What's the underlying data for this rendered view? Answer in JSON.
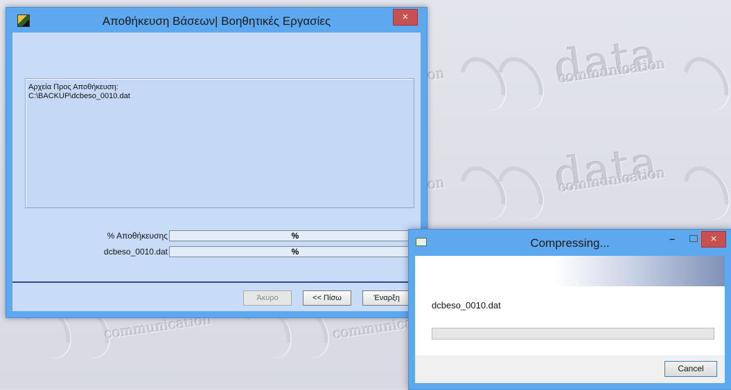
{
  "desktop": {
    "watermark_brand": "data",
    "watermark_sub": "communication",
    "watermark_fragment": "on"
  },
  "main_dialog": {
    "title": "Αποθήκευση Βάσεων| Βοηθητικές Εργασίες",
    "close_label": "×",
    "files_label": "Αρχεία Προς Αποθήκευση:",
    "file_path": "C:\\BACKUP\\dcbeso_0010.dat",
    "progress": [
      {
        "label": "% Αποθήκευσης",
        "value_text": "%"
      },
      {
        "label": "dcbeso_0010.dat",
        "value_text": "%"
      }
    ],
    "buttons": {
      "cancel": "Άκυρο",
      "back": "<< Πίσω",
      "start": "Έναρξη"
    }
  },
  "compress_dialog": {
    "title": "Compressing...",
    "minimize_label": "–",
    "close_label": "×",
    "file_name": "dcbeso_0010.dat",
    "progress_fraction": 0,
    "cancel_label": "Cancel"
  }
}
